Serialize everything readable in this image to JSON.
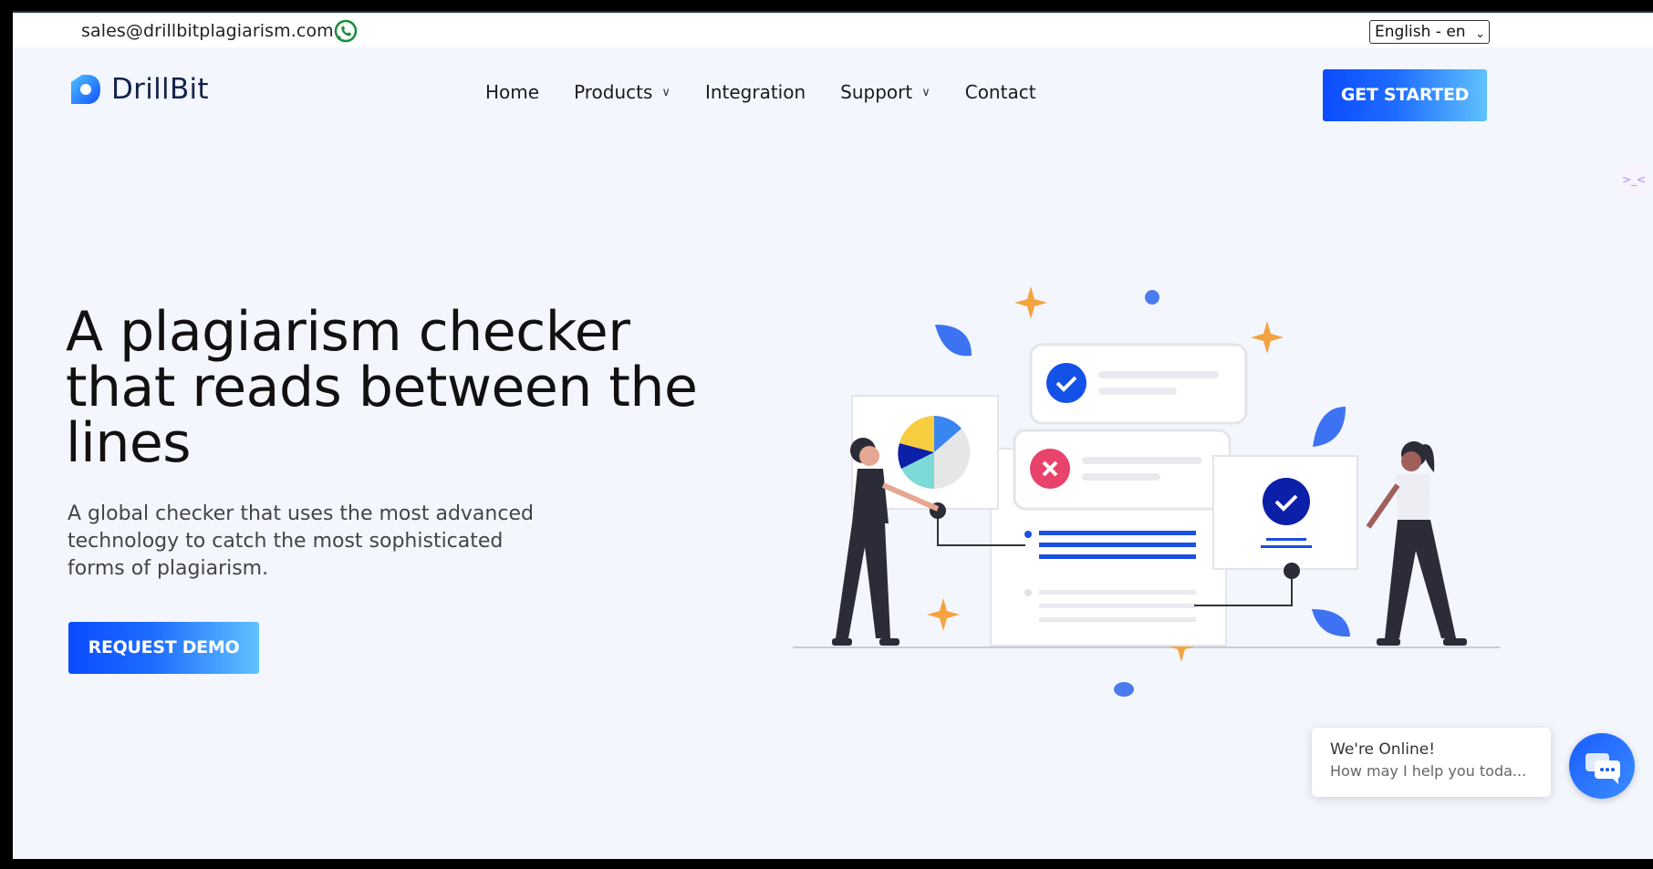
{
  "topbar": {
    "email": "sales@drillbitplagiarism.com",
    "whatsapp_icon": "whatsapp-icon",
    "language": "English - en"
  },
  "header": {
    "brand": "DrillBit",
    "nav": [
      {
        "label": "Home",
        "dropdown": false
      },
      {
        "label": "Products",
        "dropdown": true
      },
      {
        "label": "Integration",
        "dropdown": false
      },
      {
        "label": "Support",
        "dropdown": true
      },
      {
        "label": "Contact",
        "dropdown": false
      }
    ],
    "cta_label": "GET STARTED"
  },
  "hero": {
    "title_lines": [
      "A plagiarism checker",
      "that reads between the",
      "lines"
    ],
    "subtitle_lines": [
      "A global checker that uses the most advanced",
      "technology to catch the most sophisticated",
      "forms of plagiarism."
    ],
    "button_label": "REQUEST DEMO"
  },
  "chat": {
    "status": "We're Online!",
    "prompt": "How may I help you toda..."
  },
  "side_tab": {
    "label": ">_<"
  },
  "colors": {
    "accent": "#0b4bff",
    "accent_light": "#5fc2ff",
    "background": "#f3f6fd",
    "orange": "#f4a340",
    "navy": "#0c1fa8",
    "red": "#e8436a"
  }
}
